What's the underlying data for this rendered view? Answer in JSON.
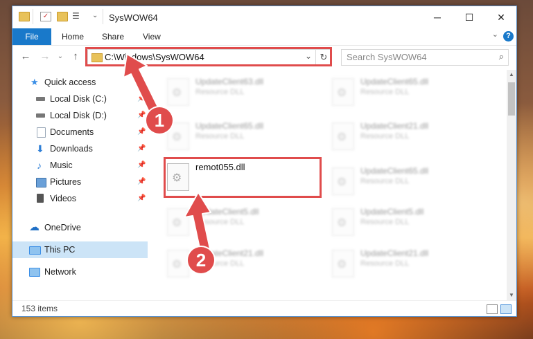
{
  "window": {
    "title": "SysWOW64"
  },
  "window_controls": {
    "minimize": "─",
    "maximize": "☐",
    "close": "✕"
  },
  "ribbon": {
    "file": "File",
    "tabs": [
      "Home",
      "Share",
      "View"
    ],
    "help": "?"
  },
  "address": {
    "path": "C:\\Windows\\SysWOW64",
    "refresh": "↻",
    "dropdown": "⌄"
  },
  "search": {
    "placeholder": "Search SysWOW64",
    "icon": "⌕"
  },
  "nav": {
    "back": "←",
    "forward": "→",
    "up": "↑",
    "chevron": "⌄"
  },
  "sidebar": {
    "items": [
      {
        "label": "Quick access",
        "icon": "star-icon",
        "color": "#3a8ee6"
      },
      {
        "label": "Local Disk (C:)",
        "icon": "drive-icon",
        "color": "#777777"
      },
      {
        "label": "Local Disk (D:)",
        "icon": "drive-icon",
        "color": "#777777"
      },
      {
        "label": "Documents",
        "icon": "document-icon",
        "color": "#9aa8b8"
      },
      {
        "label": "Downloads",
        "icon": "download-icon",
        "color": "#2f7fd6"
      },
      {
        "label": "Music",
        "icon": "music-icon",
        "color": "#2f7fd6"
      },
      {
        "label": "Pictures",
        "icon": "pictures-icon",
        "color": "#6aa0d8"
      },
      {
        "label": "Videos",
        "icon": "videos-icon",
        "color": "#555555"
      },
      {
        "label": "OneDrive",
        "icon": "cloud-icon",
        "color": "#1f6fc6"
      },
      {
        "label": "This PC",
        "icon": "computer-icon",
        "color": "#3a8ee6"
      },
      {
        "label": "Network",
        "icon": "network-icon",
        "color": "#3a8ee6"
      }
    ],
    "pin": "📌"
  },
  "files": {
    "left": [
      {
        "name": "UpdateClient63.dll",
        "type": "Resource DLL"
      },
      {
        "name": "UpdateClient65.dll",
        "type": "Resource DLL"
      },
      {
        "name": "remot055.dll",
        "type": ""
      },
      {
        "name": "UpdateClient5.dll",
        "type": "Resource DLL"
      },
      {
        "name": "UpdateClient21.dll",
        "type": "Resource DLL"
      }
    ],
    "right": [
      {
        "name": "UpdateClient65.dll",
        "type": "Resource DLL"
      },
      {
        "name": "UpdateClient21.dll",
        "type": "Resource DLL"
      },
      {
        "name": "UpdateClient65.dll",
        "type": "Resource DLL"
      },
      {
        "name": "UpdateClient5.dll",
        "type": "Resource DLL"
      },
      {
        "name": "UpdateClient21.dll",
        "type": "Resource DLL"
      }
    ]
  },
  "status": {
    "items": "153 items"
  },
  "annotations": {
    "step1": "1",
    "step2": "2",
    "color": "#e04c4c"
  }
}
